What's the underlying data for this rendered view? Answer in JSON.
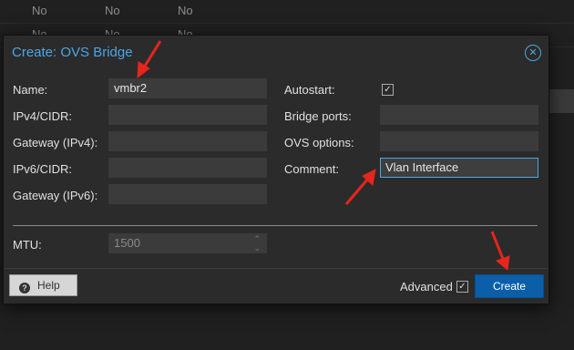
{
  "background": {
    "rows": [
      {
        "cells": [
          "No",
          "No",
          "No"
        ]
      },
      {
        "cells": [
          "No",
          "No",
          "No"
        ]
      }
    ]
  },
  "dialog": {
    "title": "Create: OVS Bridge",
    "close_icon": "close-circle-icon",
    "left_fields": [
      {
        "label": "Name:",
        "value": "vmbr2"
      },
      {
        "label": "IPv4/CIDR:",
        "value": ""
      },
      {
        "label": "Gateway (IPv4):",
        "value": ""
      },
      {
        "label": "IPv6/CIDR:",
        "value": ""
      },
      {
        "label": "Gateway (IPv6):",
        "value": ""
      }
    ],
    "right_fields": [
      {
        "label": "Autostart:",
        "checked": true
      },
      {
        "label": "Bridge ports:",
        "value": ""
      },
      {
        "label": "OVS options:",
        "value": ""
      },
      {
        "label": "Comment:",
        "value": "Vlan Interface"
      }
    ],
    "mtu": {
      "label": "MTU:",
      "placeholder": "1500"
    },
    "footer": {
      "help_label": "Help",
      "advanced_label": "Advanced",
      "advanced_checked": true,
      "create_label": "Create"
    }
  },
  "colors": {
    "accent": "#4ba6e6",
    "annotation": "#e5261d",
    "primary_button": "#0a5fa8"
  }
}
